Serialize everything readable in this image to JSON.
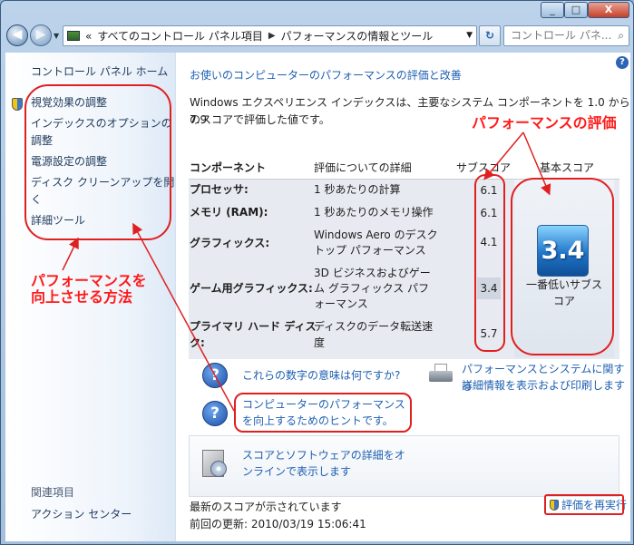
{
  "window": {
    "buttons": {
      "min": "_",
      "max": "□",
      "close": "X"
    }
  },
  "address": {
    "overflow": "«",
    "crumbs": [
      "すべてのコントロール パネル項目",
      "パフォーマンスの情報とツール"
    ],
    "search_placeholder": "コントロール パネ..."
  },
  "sidebar": {
    "home": "コントロール パネル ホーム",
    "links": [
      "視覚効果の調整",
      "インデックスのオプションの",
      "調整",
      "電源設定の調整",
      "ディスク クリーンアップを開",
      "く",
      "詳細ツール"
    ],
    "related_header": "関連項目",
    "related": [
      "アクション センター"
    ]
  },
  "main": {
    "heading": "お使いのコンピューターのパフォーマンスの評価と改善",
    "intro": [
      "Windows エクスペリエンス インデックスは、主要なシステム コンポーネントを 1.0 から 7.9",
      "のスコアで評価した値です。"
    ],
    "columns": {
      "component": "コンポーネント",
      "detail": "評価についての詳細",
      "subscore": "サブスコア",
      "basescore": "基本スコア"
    },
    "rows": [
      {
        "component": [
          "プロセッサ:"
        ],
        "detail": [
          "1 秒あたりの計算"
        ],
        "score": "6.1"
      },
      {
        "component": [
          "メモリ (RAM):"
        ],
        "detail": [
          "1 秒あたりのメモリ操作"
        ],
        "score": "6.1"
      },
      {
        "component": [
          "グラフィックス:"
        ],
        "detail": [
          "Windows Aero のデスク",
          "トップ パフォーマンス"
        ],
        "score": "4.1"
      },
      {
        "component": [
          "ゲーム用グラフィックス:"
        ],
        "detail": [
          "3D ビジネスおよびゲー",
          "ム グラフィックス パフ",
          "ォーマンス"
        ],
        "score": "3.4"
      },
      {
        "component": [
          "プライマリ ハード ディス",
          "ク:"
        ],
        "detail": [
          "ディスクのデータ転送速",
          "度"
        ],
        "score": "5.7"
      }
    ],
    "base_score": "3.4",
    "base_caption": [
      "一番低いサブス",
      "コア"
    ],
    "links": {
      "meaning": "これらの数字の意味は何ですか?",
      "print": [
        "パフォーマンスとシステムに関する",
        "詳細情報を表示および印刷します"
      ],
      "tips": [
        "コンピューターのパフォーマンス",
        "を向上するためのヒントです。"
      ],
      "online": [
        "スコアとソフトウェアの詳細をオ",
        "ンラインで表示します"
      ]
    },
    "status": "最新のスコアが示されています",
    "last_update": "前回の更新: 2010/03/19 15:06:41",
    "rerun": "評価を再実行"
  },
  "annotations": {
    "perf_eval": "パフォーマンスの評価",
    "improve": [
      "パフォーマンスを",
      "向上させる方法"
    ],
    "color": "#ff1a1a"
  }
}
